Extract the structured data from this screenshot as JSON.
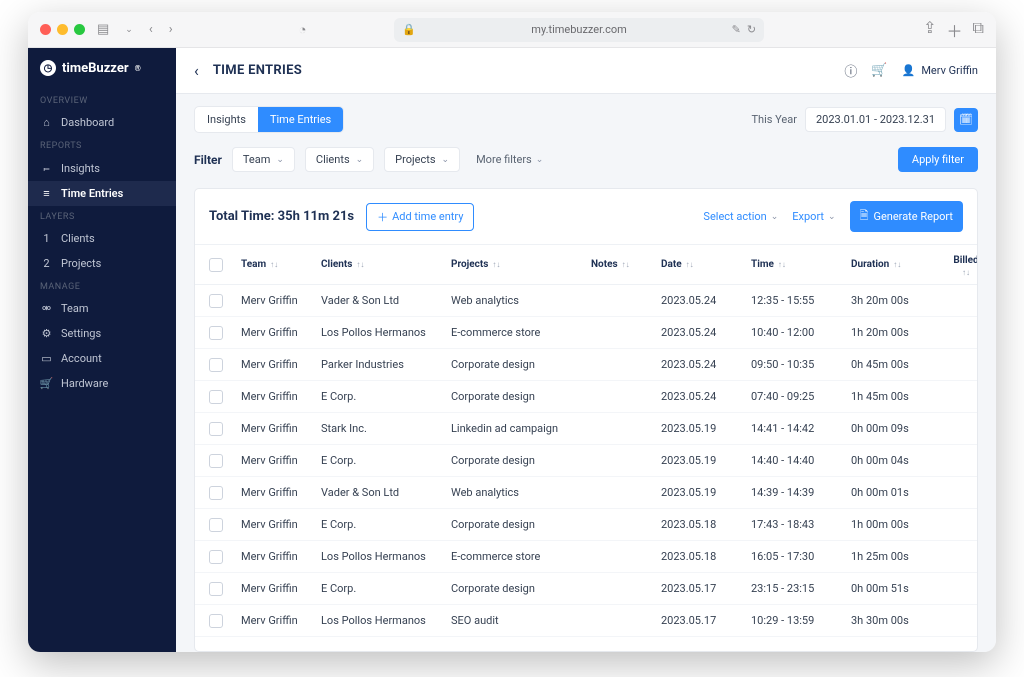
{
  "browser": {
    "url": "my.timebuzzer.com"
  },
  "brand": "timeBuzzer",
  "sidebar": {
    "sections": [
      {
        "label": "OVERVIEW",
        "items": [
          {
            "icon": "⌂",
            "label": "Dashboard"
          }
        ]
      },
      {
        "label": "REPORTS",
        "items": [
          {
            "icon": "⫭",
            "label": "Insights"
          },
          {
            "icon": "≡",
            "label": "Time Entries",
            "active": true
          }
        ]
      },
      {
        "label": "LAYERS",
        "items": [
          {
            "icon": "1",
            "label": "Clients"
          },
          {
            "icon": "2",
            "label": "Projects"
          }
        ]
      },
      {
        "label": "MANAGE",
        "items": [
          {
            "icon": "⚮",
            "label": "Team"
          },
          {
            "icon": "⚙",
            "label": "Settings"
          },
          {
            "icon": "▭",
            "label": "Account"
          },
          {
            "icon": "🛒",
            "label": "Hardware"
          }
        ]
      }
    ]
  },
  "page_title": "TIME ENTRIES",
  "user_name": "Merv Griffin",
  "tabs": {
    "insights": "Insights",
    "time_entries": "Time Entries"
  },
  "date": {
    "label": "This Year",
    "range": "2023.01.01 - 2023.12.31"
  },
  "filter": {
    "label": "Filter",
    "team": "Team",
    "clients": "Clients",
    "projects": "Projects",
    "more": "More filters",
    "apply": "Apply filter"
  },
  "table": {
    "total_prefix": "Total Time: ",
    "total_value": "35h 11m 21s",
    "add": "Add time entry",
    "select_action": "Select action",
    "export": "Export",
    "generate": "Generate Report",
    "cols": {
      "team": "Team",
      "clients": "Clients",
      "projects": "Projects",
      "notes": "Notes",
      "date": "Date",
      "time": "Time",
      "duration": "Duration",
      "billed": "Billed"
    },
    "rows": [
      {
        "team": "Merv Griffin",
        "client": "Vader & Son Ltd",
        "project": "Web analytics",
        "notes": "",
        "date": "2023.05.24",
        "time": "12:35 - 15:55",
        "duration": "3h 20m 00s"
      },
      {
        "team": "Merv Griffin",
        "client": "Los Pollos Hermanos",
        "project": "E-commerce store",
        "notes": "",
        "date": "2023.05.24",
        "time": "10:40 - 12:00",
        "duration": "1h 20m 00s"
      },
      {
        "team": "Merv Griffin",
        "client": "Parker Industries",
        "project": "Corporate design",
        "notes": "",
        "date": "2023.05.24",
        "time": "09:50 - 10:35",
        "duration": "0h 45m 00s"
      },
      {
        "team": "Merv Griffin",
        "client": "E Corp.",
        "project": "Corporate design",
        "notes": "",
        "date": "2023.05.24",
        "time": "07:40 - 09:25",
        "duration": "1h 45m 00s"
      },
      {
        "team": "Merv Griffin",
        "client": "Stark Inc.",
        "project": "Linkedin ad campaign",
        "notes": "",
        "date": "2023.05.19",
        "time": "14:41 - 14:42",
        "duration": "0h 00m 09s"
      },
      {
        "team": "Merv Griffin",
        "client": "E Corp.",
        "project": "Corporate design",
        "notes": "",
        "date": "2023.05.19",
        "time": "14:40 - 14:40",
        "duration": "0h 00m 04s"
      },
      {
        "team": "Merv Griffin",
        "client": "Vader & Son Ltd",
        "project": "Web analytics",
        "notes": "",
        "date": "2023.05.19",
        "time": "14:39 - 14:39",
        "duration": "0h 00m 01s"
      },
      {
        "team": "Merv Griffin",
        "client": "E Corp.",
        "project": "Corporate design",
        "notes": "",
        "date": "2023.05.18",
        "time": "17:43 - 18:43",
        "duration": "1h 00m 00s"
      },
      {
        "team": "Merv Griffin",
        "client": "Los Pollos Hermanos",
        "project": "E-commerce store",
        "notes": "",
        "date": "2023.05.18",
        "time": "16:05 - 17:30",
        "duration": "1h 25m 00s"
      },
      {
        "team": "Merv Griffin",
        "client": "E Corp.",
        "project": "Corporate design",
        "notes": "",
        "date": "2023.05.17",
        "time": "23:15 - 23:15",
        "duration": "0h 00m 51s"
      },
      {
        "team": "Merv Griffin",
        "client": "Los Pollos Hermanos",
        "project": "SEO audit",
        "notes": "",
        "date": "2023.05.17",
        "time": "10:29 - 13:59",
        "duration": "3h 30m 00s"
      }
    ]
  }
}
